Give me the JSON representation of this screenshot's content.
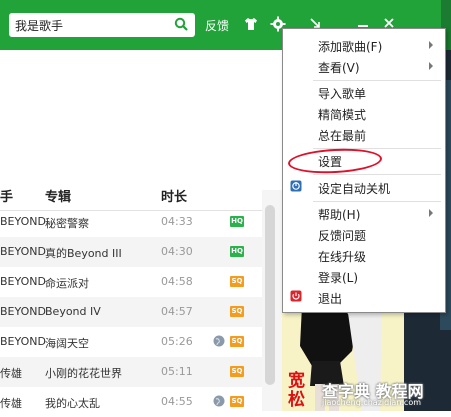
{
  "toolbar": {
    "search_value": "我是歌手",
    "feedback_label": "反馈"
  },
  "list": {
    "headers": {
      "singer": "手",
      "album": "专辑",
      "duration": "时长"
    },
    "rows": [
      {
        "singer": "BEYOND",
        "album": "秘密警察",
        "time": "04:33",
        "badge": "HQ",
        "globe": false
      },
      {
        "singer": "BEYOND",
        "album": "真的Beyond III",
        "time": "04:30",
        "badge": "HQ",
        "globe": false
      },
      {
        "singer": "BEYOND",
        "album": "命运派对",
        "time": "04:58",
        "badge": "SQ",
        "globe": false
      },
      {
        "singer": "BEYOND",
        "album": "Beyond IV",
        "time": "04:57",
        "badge": "SQ",
        "globe": false
      },
      {
        "singer": "BEYOND",
        "album": "海阔天空",
        "time": "05:26",
        "badge": "SQ",
        "globe": true
      },
      {
        "singer": "传雄",
        "album": "小刚的花花世界",
        "time": "05:11",
        "badge": "SQ",
        "globe": false
      },
      {
        "singer": "传雄",
        "album": "我的心太乱",
        "time": "04:55",
        "badge": "SQ",
        "globe": true
      }
    ]
  },
  "menu": {
    "items": [
      {
        "label": "添加歌曲(F)",
        "submenu": true
      },
      {
        "label": "查看(V)",
        "submenu": true
      },
      {
        "label": "导入歌单",
        "submenu": false
      },
      {
        "label": "精简模式",
        "submenu": false
      },
      {
        "label": "总在最前",
        "submenu": false
      },
      {
        "label": "设置",
        "submenu": false
      },
      {
        "label": "设定自动关机",
        "submenu": false
      },
      {
        "label": "帮助(H)",
        "submenu": true
      },
      {
        "label": "反馈问题",
        "submenu": false
      },
      {
        "label": "在线升级",
        "submenu": false
      },
      {
        "label": "登录(L)",
        "submenu": false
      },
      {
        "label": "退出",
        "submenu": false
      }
    ]
  },
  "poster": {
    "text": "宽松"
  },
  "watermark": {
    "title": "查字典 教程网",
    "url": "jiaocheng.chazidian.com"
  },
  "colors": {
    "brand_green": "#22a33a",
    "badge_hq": "#2bb24c",
    "badge_sq": "#f39c1f",
    "highlight_red": "#e0102a"
  }
}
